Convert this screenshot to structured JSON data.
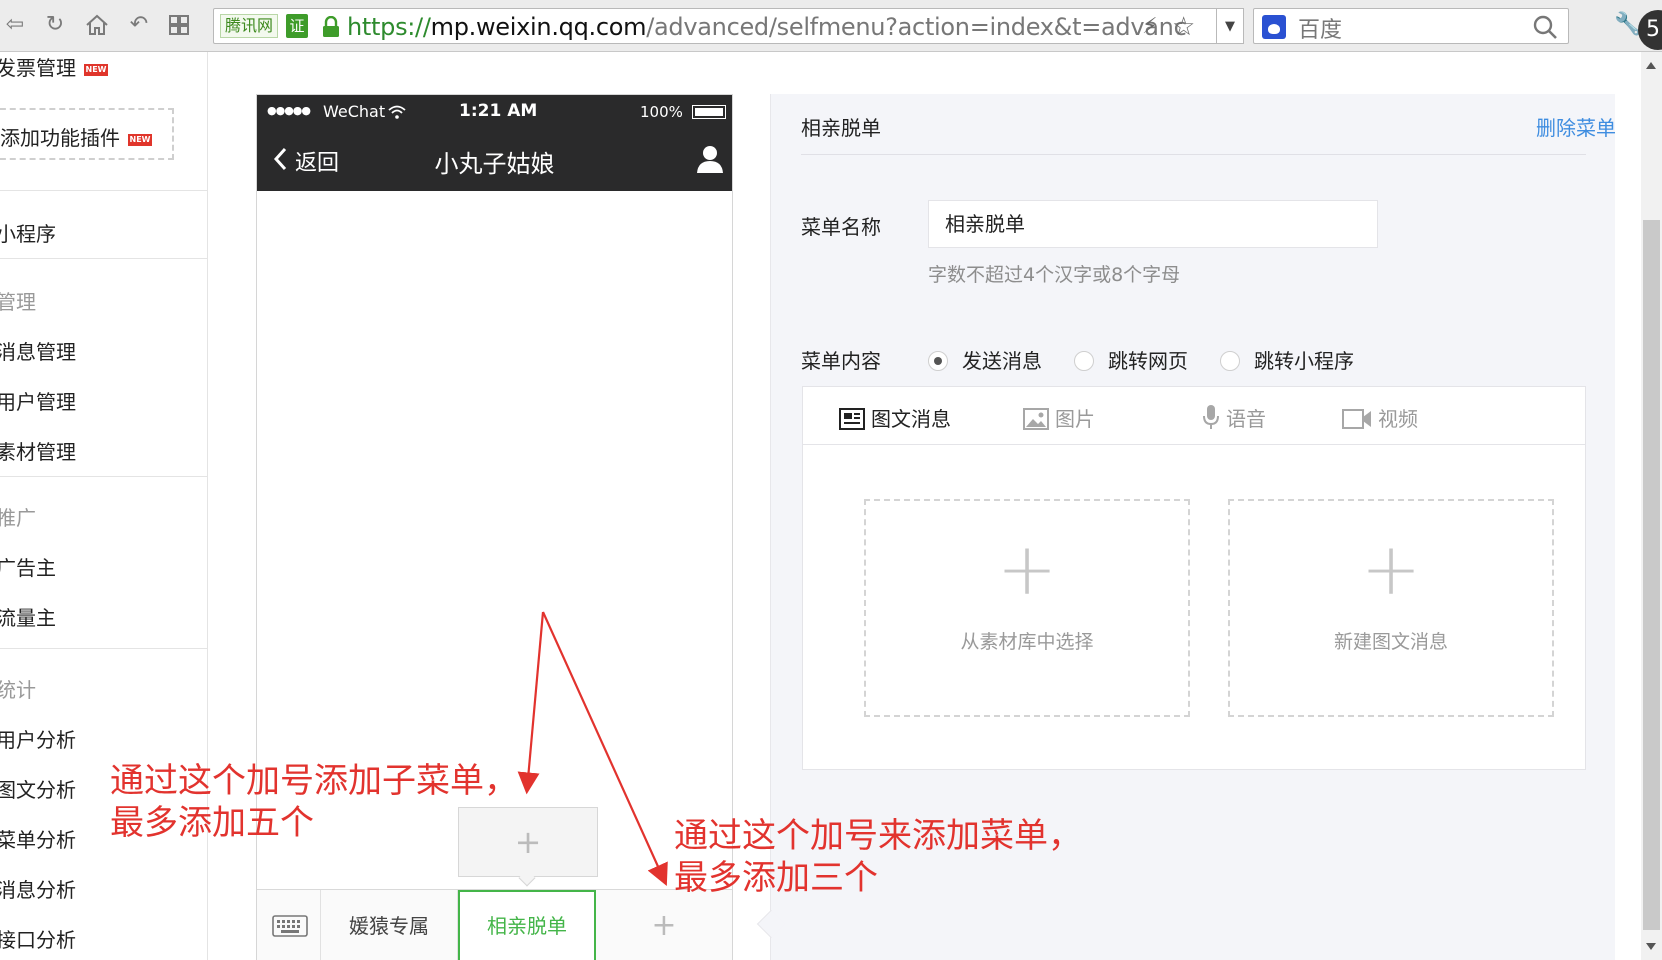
{
  "browser": {
    "site_label": "腾讯网",
    "cert_label": "证",
    "url_scheme": "https://",
    "url_host": "mp.weixin.qq.com",
    "url_path": "/advanced/selfmenu?action=index&t=advanc",
    "search_engine": "百度",
    "corner_badge": "5"
  },
  "sidebar": {
    "items": [
      {
        "label": "发票管理",
        "kind": "item",
        "new": true
      },
      {
        "label": "添加功能插件",
        "kind": "plugin",
        "new": true
      },
      {
        "label": "小程序",
        "kind": "item"
      },
      {
        "label": "管理",
        "kind": "head"
      },
      {
        "label": "消息管理",
        "kind": "item"
      },
      {
        "label": "用户管理",
        "kind": "item"
      },
      {
        "label": "素材管理",
        "kind": "item"
      },
      {
        "label": "推广",
        "kind": "head"
      },
      {
        "label": "广告主",
        "kind": "item"
      },
      {
        "label": "流量主",
        "kind": "item"
      },
      {
        "label": "统计",
        "kind": "head"
      },
      {
        "label": "用户分析",
        "kind": "item"
      },
      {
        "label": "图文分析",
        "kind": "item"
      },
      {
        "label": "菜单分析",
        "kind": "item"
      },
      {
        "label": "消息分析",
        "kind": "item"
      },
      {
        "label": "接口分析",
        "kind": "item"
      }
    ],
    "new_badge": "NEW"
  },
  "phone": {
    "signal": "●●●●●",
    "carrier": "WeChat",
    "time": "1:21 AM",
    "battery": "100%",
    "back_label": "返回",
    "chat_title": "小丸子姑娘",
    "menu_items": [
      "媛猿专属",
      "相亲脱单"
    ],
    "add_menu_glyph": "+",
    "add_submenu_glyph": "+"
  },
  "editor": {
    "title": "相亲脱单",
    "delete_label": "删除菜单",
    "name_label": "菜单名称",
    "name_value": "相亲脱单",
    "name_hint": "字数不超过4个汉字或8个字母",
    "content_label": "菜单内容",
    "radio_options": [
      {
        "label": "发送消息",
        "selected": true
      },
      {
        "label": "跳转网页",
        "selected": false
      },
      {
        "label": "跳转小程序",
        "selected": false
      }
    ],
    "tabs": [
      {
        "label": "图文消息",
        "icon": "news-icon",
        "active": true
      },
      {
        "label": "图片",
        "icon": "image-icon",
        "active": false
      },
      {
        "label": "语音",
        "icon": "microphone-icon",
        "active": false
      },
      {
        "label": "视频",
        "icon": "video-icon",
        "active": false
      }
    ],
    "cards": [
      {
        "label": "从素材库中选择",
        "glyph": "+"
      },
      {
        "label": "新建图文消息",
        "glyph": "+"
      }
    ]
  },
  "annotations": {
    "submenu_note": [
      "通过这个加号添加子菜单，",
      "最多添加五个"
    ],
    "menu_note": [
      "通过这个加号来添加菜单，",
      "最多添加三个"
    ],
    "color": "#e2332e"
  },
  "colors": {
    "accent_green": "#44b549",
    "link_blue": "#3f8de0",
    "phone_header": "#2a2a2b"
  }
}
